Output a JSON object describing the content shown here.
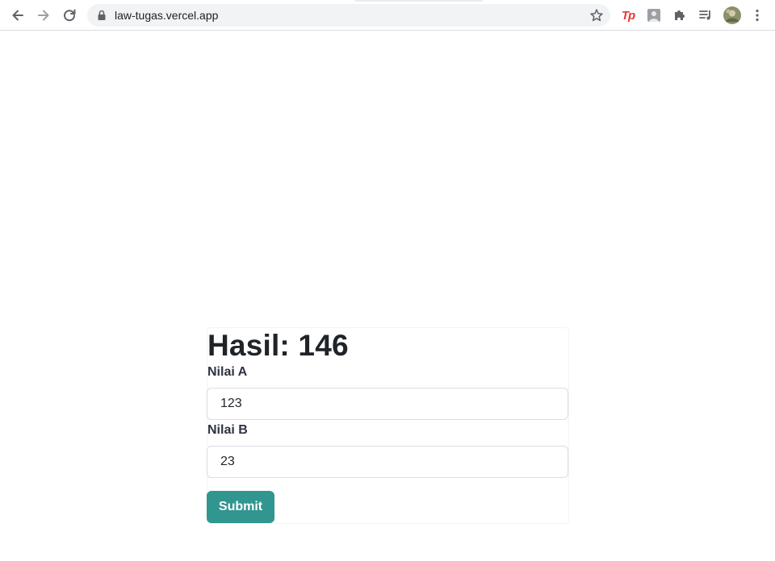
{
  "browser": {
    "url": "law-tugas.vercel.app",
    "icons": {
      "back": "back-arrow-icon",
      "forward": "forward-arrow-icon",
      "reload": "reload-icon",
      "lock": "lock-icon",
      "star": "star-icon",
      "ext_tp": "tp-extension-icon",
      "ext_photo": "photo-extension-icon",
      "extensions": "puzzle-icon",
      "media": "media-queue-icon",
      "profile": "avatar",
      "menu": "kebab-menu-icon"
    },
    "ext_tp_text": "Tp"
  },
  "page": {
    "result": "Hasil: 146",
    "field_a": {
      "label": "Nilai A",
      "value": "123"
    },
    "field_b": {
      "label": "Nilai B",
      "value": "23"
    },
    "submit_label": "Submit"
  },
  "colors": {
    "accent": "#31968f",
    "title_text": "#1f2429",
    "tp_red": "#e53935"
  }
}
